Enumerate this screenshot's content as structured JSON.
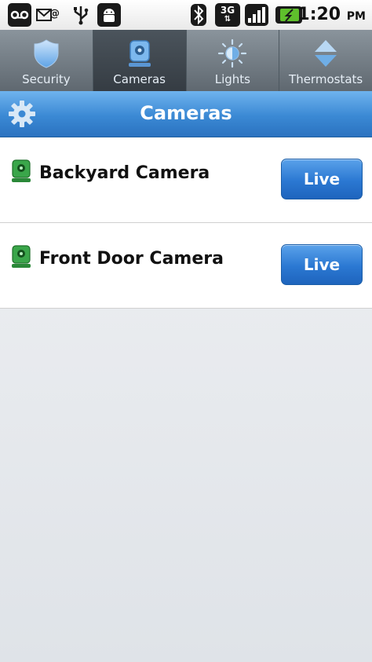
{
  "status_bar": {
    "time": "1:20",
    "ampm": "PM",
    "network": "3G",
    "icons": [
      "voicemail-icon",
      "mail-icon",
      "usb-icon",
      "android-icon",
      "bluetooth-icon",
      "network-3g-icon",
      "signal-icon",
      "battery-icon"
    ]
  },
  "tabs": [
    {
      "label": "Security",
      "icon": "shield-icon",
      "active": false
    },
    {
      "label": "Cameras",
      "icon": "camera-icon",
      "active": true
    },
    {
      "label": "Lights",
      "icon": "light-icon",
      "active": false
    },
    {
      "label": "Thermostats",
      "icon": "thermostat-icon",
      "active": false
    }
  ],
  "header": {
    "title": "Cameras",
    "settings_icon": "gear-icon"
  },
  "cameras": [
    {
      "name": "Backyard Camera",
      "button_label": "Live"
    },
    {
      "name": "Front Door Camera",
      "button_label": "Live"
    }
  ],
  "colors": {
    "header_blue": "#3b89d4",
    "button_blue": "#2b78d2",
    "camera_green": "#2e9a3a"
  }
}
